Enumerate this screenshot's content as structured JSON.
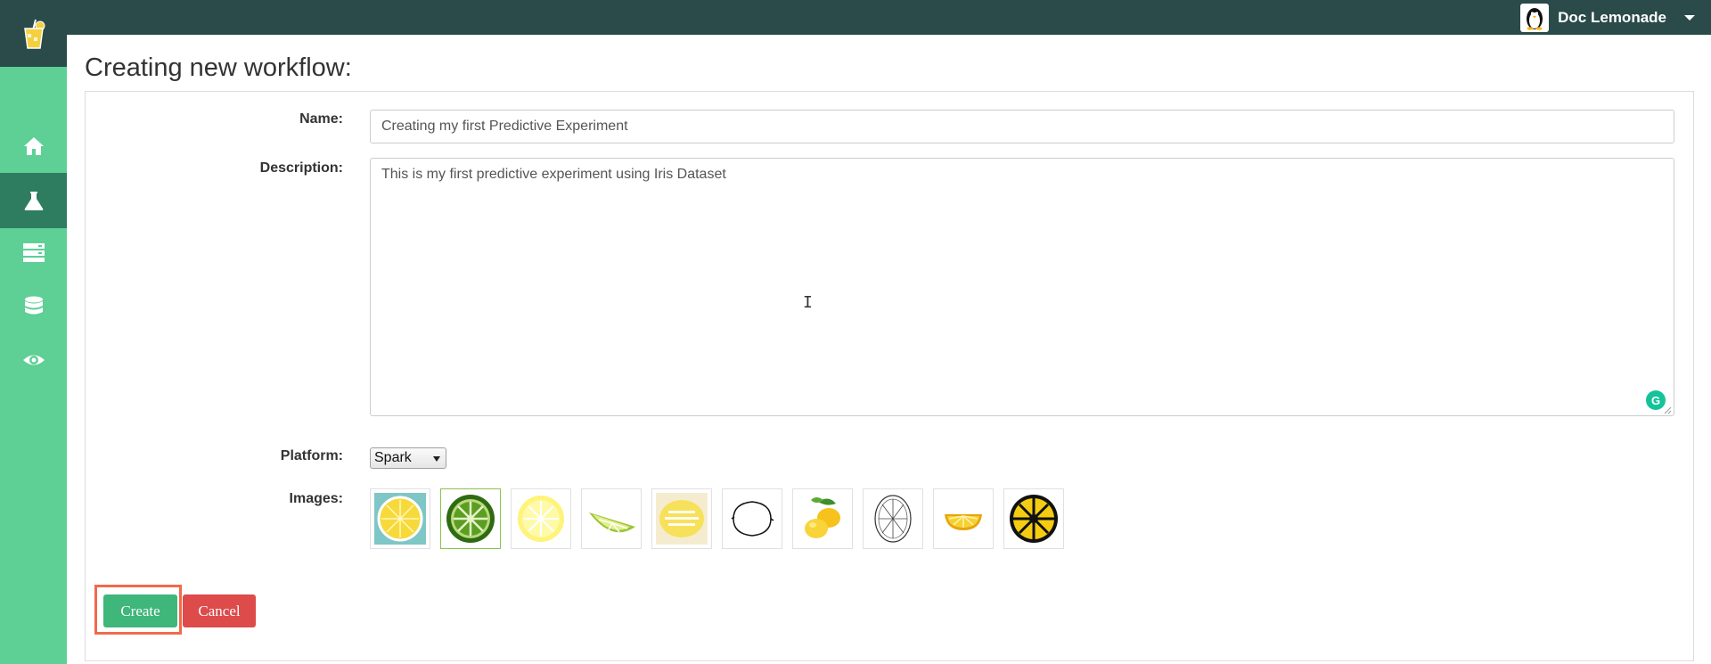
{
  "user": {
    "name": "Doc Lemonade",
    "avatar_icon": "penguin-icon"
  },
  "sidebar": {
    "items": [
      {
        "icon": "home-icon",
        "active": false
      },
      {
        "icon": "flask-icon",
        "active": true
      },
      {
        "icon": "server-icon",
        "active": false
      },
      {
        "icon": "database-icon",
        "active": false
      },
      {
        "icon": "eye-icon",
        "active": false
      }
    ]
  },
  "page": {
    "title": "Creating new workflow:"
  },
  "form": {
    "name_label": "Name:",
    "name_value": "Creating my first Predictive Experiment",
    "description_label": "Description:",
    "description_value": "This is my first predictive experiment using Iris Dataset",
    "platform_label": "Platform:",
    "platform_value": "Spark",
    "images_label": "Images:",
    "images": [
      {
        "name": "lemon-slice-teal-bg",
        "selected": false
      },
      {
        "name": "lime-slice-dark-green",
        "selected": true
      },
      {
        "name": "lemon-slice-pale-yellow",
        "selected": false
      },
      {
        "name": "lime-wedge",
        "selected": false
      },
      {
        "name": "lemon-text-logo",
        "selected": false
      },
      {
        "name": "lemon-outline",
        "selected": false
      },
      {
        "name": "lemons-with-leaves",
        "selected": false
      },
      {
        "name": "lemon-slice-sketch",
        "selected": false
      },
      {
        "name": "lemon-half-wedge",
        "selected": false
      },
      {
        "name": "lemon-slice-black",
        "selected": false
      }
    ]
  },
  "buttons": {
    "create": "Create",
    "cancel": "Cancel"
  },
  "colors": {
    "topbar": "#2b4a4a",
    "sidebar": "#5ecf95",
    "sidebar_active": "#2e7d60",
    "create": "#3fb67a",
    "cancel": "#dd4b4b",
    "highlight": "#f06a4c"
  }
}
